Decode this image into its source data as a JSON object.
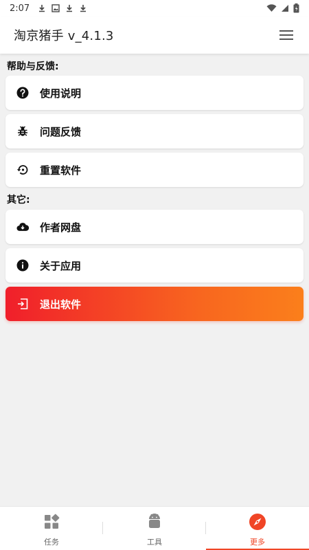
{
  "status_bar": {
    "time": "2:07",
    "icons": [
      "download-icon",
      "image-icon",
      "download-icon",
      "download-icon",
      "wifi-icon",
      "signal-icon",
      "battery-icon"
    ]
  },
  "app_bar": {
    "title": "淘京猪手 v_4.1.3",
    "menu_icon": "hamburger-menu-icon"
  },
  "sections": {
    "help": {
      "title": "帮助与反馈:",
      "items": [
        {
          "label": "使用说明",
          "icon": "help-circle-icon"
        },
        {
          "label": "问题反馈",
          "icon": "bug-icon"
        },
        {
          "label": "重置软件",
          "icon": "restore-icon"
        }
      ]
    },
    "other": {
      "title": "其它:",
      "items": [
        {
          "label": "作者网盘",
          "icon": "cloud-download-icon"
        },
        {
          "label": "关于应用",
          "icon": "info-icon"
        },
        {
          "label": "退出软件",
          "icon": "logout-icon"
        }
      ]
    }
  },
  "bottom_nav": {
    "items": [
      {
        "label": "任务",
        "icon": "grid-icon",
        "active": false
      },
      {
        "label": "工具",
        "icon": "android-icon",
        "active": false
      },
      {
        "label": "更多",
        "icon": "compass-icon",
        "active": true
      }
    ]
  },
  "colors": {
    "accent": "#f04526",
    "gradient_start": "#f01f2b",
    "gradient_end": "#fb7f1b",
    "background": "#f1f1f1"
  }
}
